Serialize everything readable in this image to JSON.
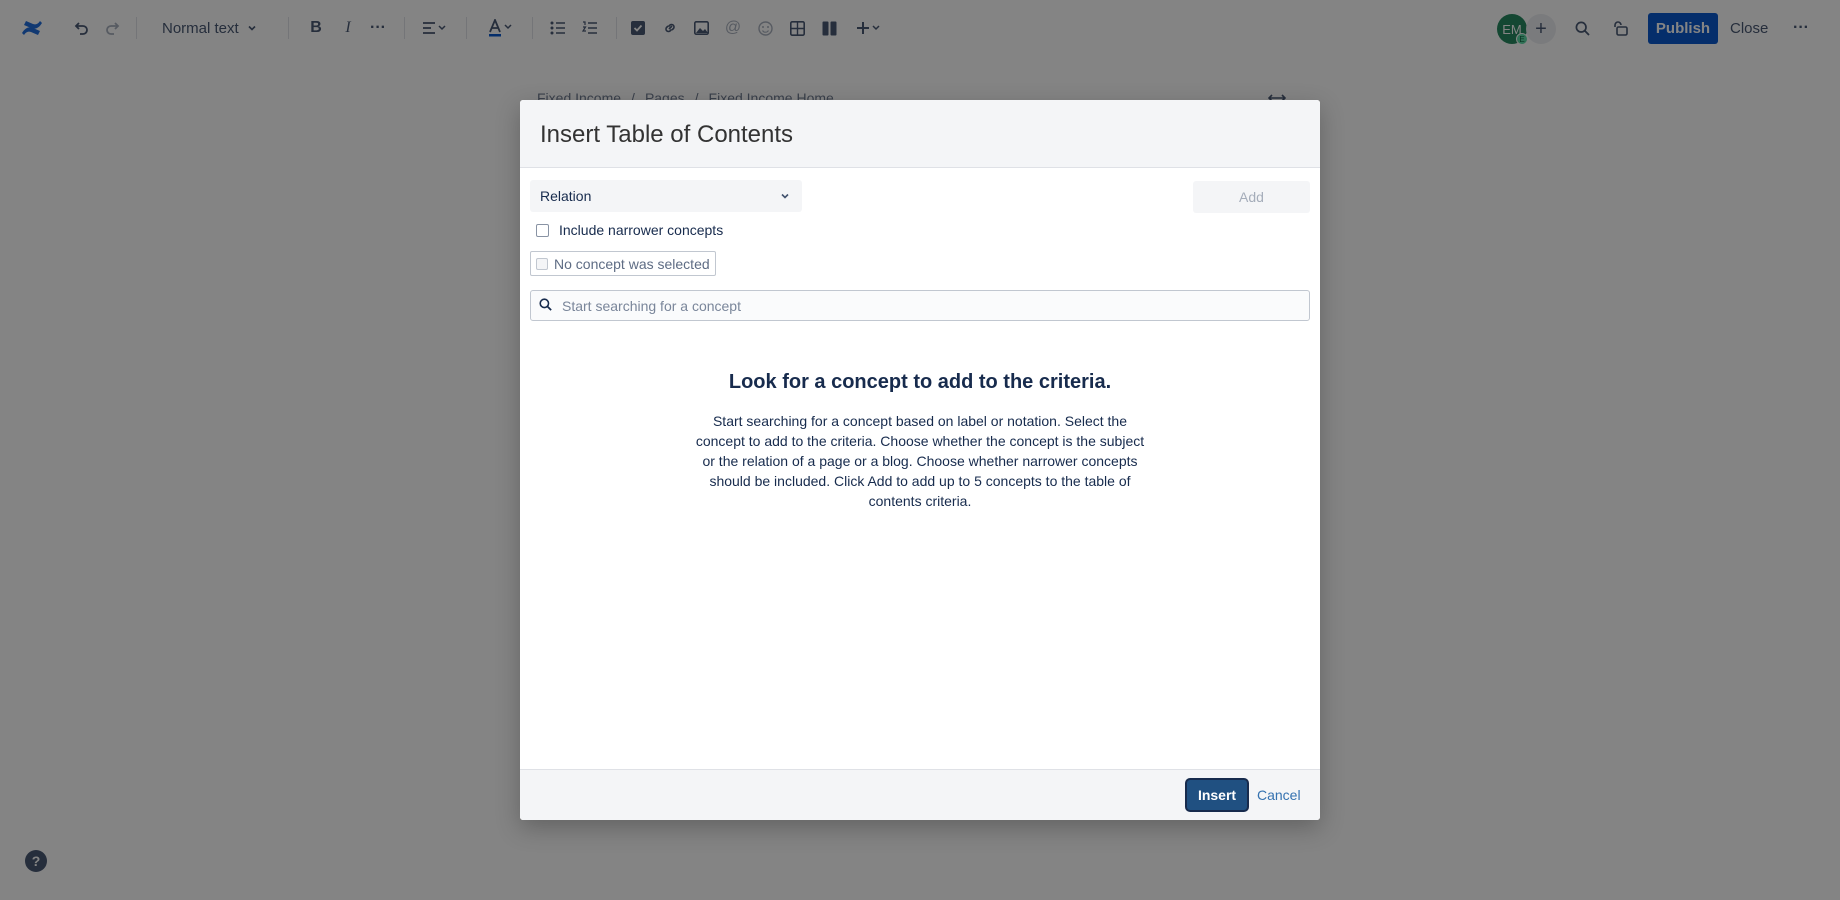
{
  "toolbar": {
    "text_style": "Normal text",
    "avatar_initials": "EM",
    "avatar_badge": "E",
    "publish_label": "Publish",
    "close_label": "Close"
  },
  "breadcrumb": [
    "Fixed Income",
    "Pages",
    "Fixed Income Home"
  ],
  "breadcrumb_separator": "/",
  "dialog": {
    "title": "Insert Table of Contents",
    "relation_select_value": "Relation",
    "add_label": "Add",
    "include_narrower_label": "Include narrower concepts",
    "no_concept_label": "No concept was selected",
    "search_placeholder": "Start searching for a concept",
    "empty_title": "Look for a concept to add to the criteria.",
    "empty_description": "Start searching for a concept based on label or notation. Select the concept to add to the criteria. Choose whether the concept is the subject or the relation of a page or a blog. Choose whether narrower concepts should be included. Click Add to add up to 5 concepts to the table of contents criteria.",
    "insert_label": "Insert",
    "cancel_label": "Cancel"
  },
  "help_label": "?",
  "colors": {
    "overlay": "rgba(9,9,9,0.5)",
    "publish": "#0052cc",
    "insert": "#205081",
    "link": "#3572b0",
    "avatar": "#1f845a"
  }
}
